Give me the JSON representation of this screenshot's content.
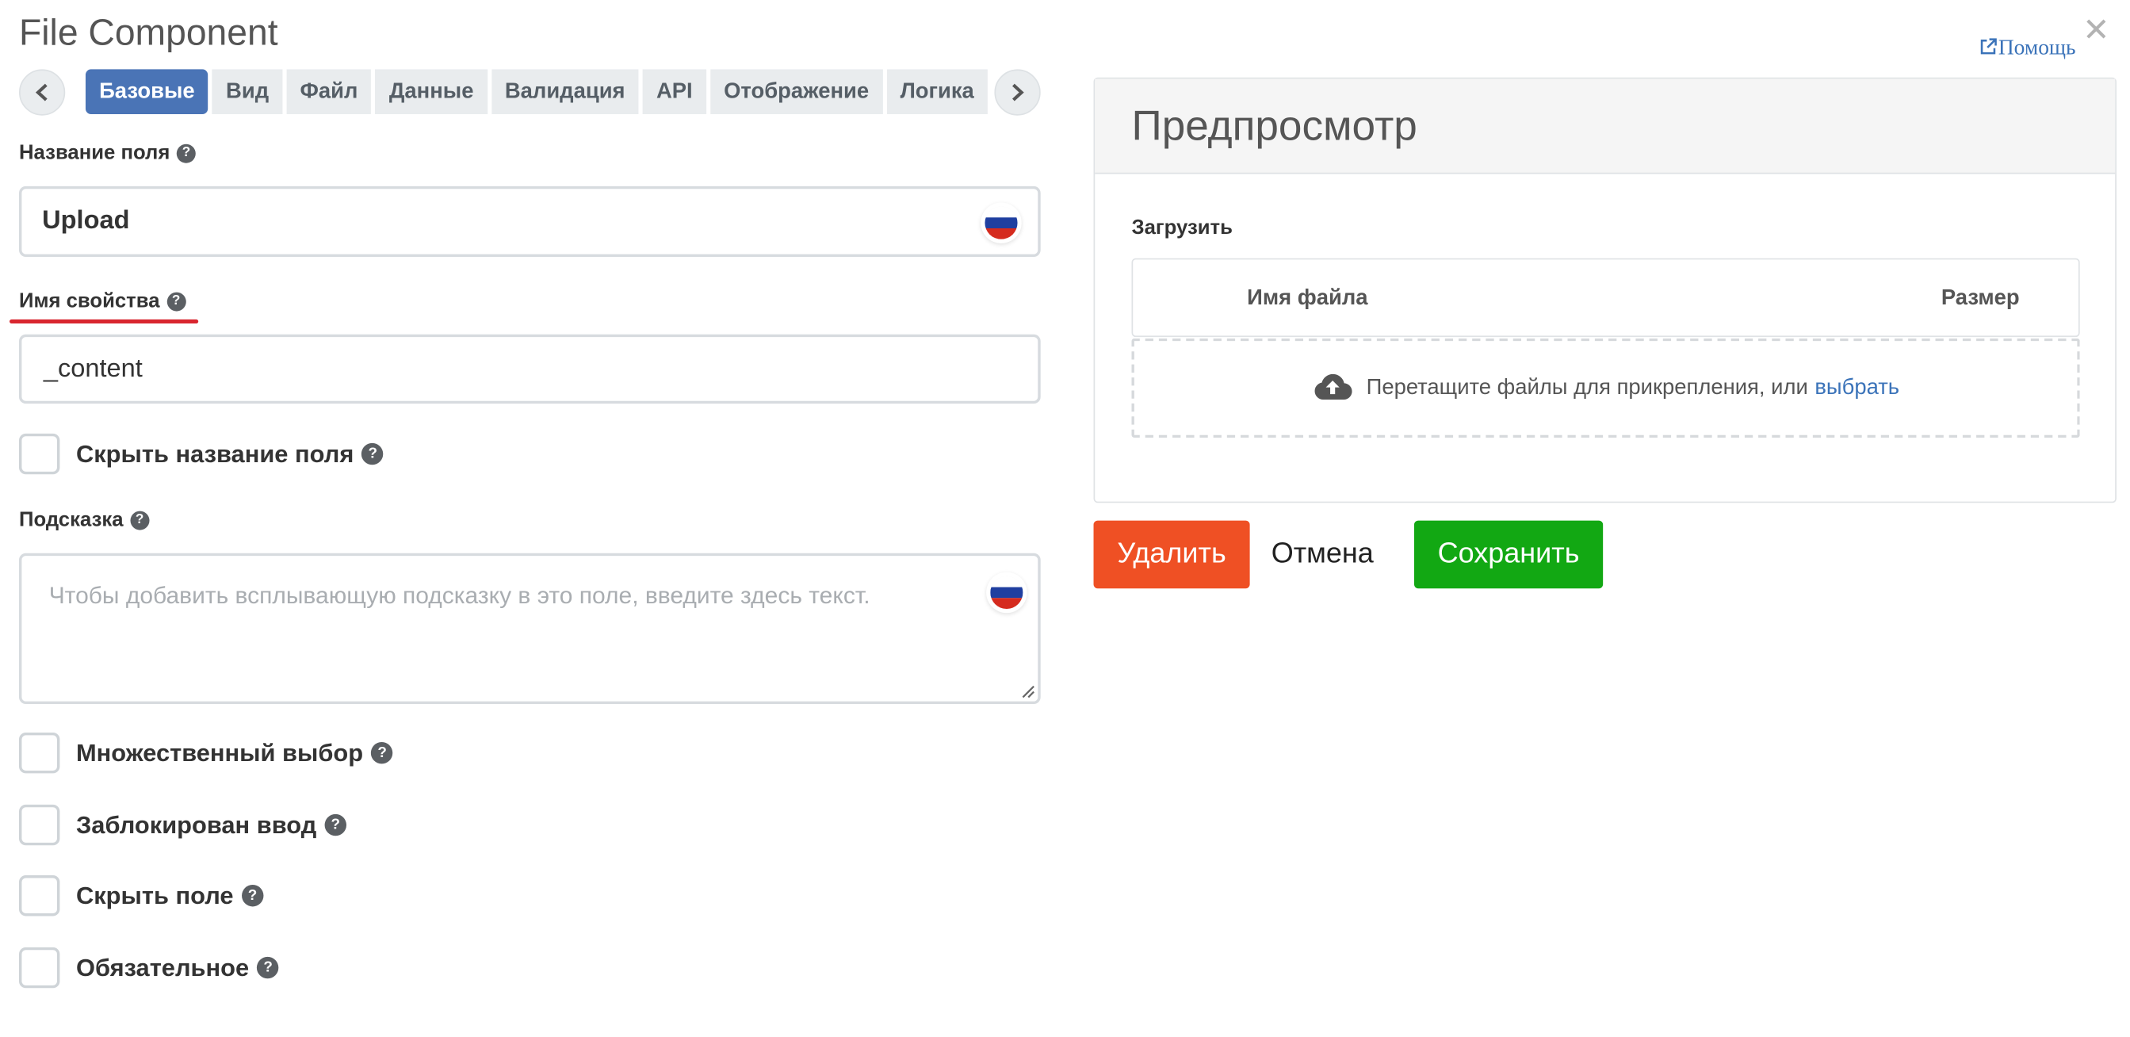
{
  "header": {
    "title": "File Component",
    "help_label": "Помощь",
    "close_glyph": "✕"
  },
  "tabs": [
    {
      "label": "Базовые",
      "active": true
    },
    {
      "label": "Вид",
      "active": false
    },
    {
      "label": "Файл",
      "active": false
    },
    {
      "label": "Данные",
      "active": false
    },
    {
      "label": "Валидация",
      "active": false
    },
    {
      "label": "API",
      "active": false
    },
    {
      "label": "Отображение",
      "active": false
    },
    {
      "label": "Логика",
      "active": false
    }
  ],
  "form": {
    "field_label": {
      "label": "Название поля",
      "value": "Upload"
    },
    "property_name": {
      "label": "Имя свойства",
      "value": "_content"
    },
    "hide_label": {
      "label": "Скрыть название поля",
      "checked": false
    },
    "tooltip": {
      "label": "Подсказка",
      "placeholder": "Чтобы добавить всплывающую подсказку в это поле, введите здесь текст."
    },
    "multiple": {
      "label": "Множественный выбор",
      "checked": false
    },
    "disabled": {
      "label": "Заблокирован ввод",
      "checked": false
    },
    "hidden": {
      "label": "Скрыть поле",
      "checked": false
    },
    "required": {
      "label": "Обязательное",
      "checked": false
    }
  },
  "preview": {
    "title": "Предпросмотр",
    "upload_label": "Загрузить",
    "col_filename": "Имя файла",
    "col_size": "Размер",
    "drop_text": "Перетащите файлы для прикрепления, или",
    "drop_link": "выбрать"
  },
  "buttons": {
    "remove": "Удалить",
    "cancel": "Отмена",
    "save": "Сохранить"
  },
  "colors": {
    "tab_active": "#4a74b6",
    "btn_remove": "#ef5024",
    "btn_save": "#12a813",
    "link": "#3b73b9",
    "underline_marker": "#d9262f",
    "flag": [
      "#ffffff",
      "#1f3fa0",
      "#d52b1e"
    ]
  },
  "icons": {
    "help": "question-circle-icon",
    "flag": "russia-flag-icon",
    "upload": "cloud-upload-icon",
    "external": "external-link-icon",
    "prev": "chevron-left-icon",
    "next": "chevron-right-icon"
  }
}
